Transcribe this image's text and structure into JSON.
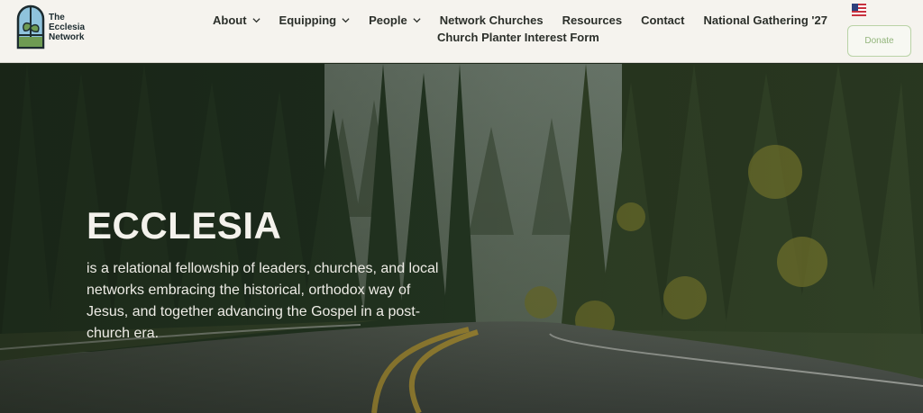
{
  "brand": {
    "name_line1": "The",
    "name_line2": "Ecclesia",
    "name_line3": "Network"
  },
  "nav": {
    "row1": [
      {
        "label": "About",
        "dropdown": true
      },
      {
        "label": "Equipping",
        "dropdown": true
      },
      {
        "label": "People",
        "dropdown": true
      },
      {
        "label": "Network Churches",
        "dropdown": false
      },
      {
        "label": "Resources",
        "dropdown": false
      },
      {
        "label": "Contact",
        "dropdown": false
      },
      {
        "label": "National Gathering '27",
        "dropdown": false
      }
    ],
    "row2": [
      {
        "label": "Church Planter Interest Form",
        "dropdown": false
      }
    ]
  },
  "language_flag": "us-flag-icon",
  "donate": {
    "label": "Donate"
  },
  "hero": {
    "title": "ECCLESIA",
    "text": "is a relational fellowship of leaders, churches, and local networks embracing the historical, orthodox way of Jesus, and together advancing the Gospel in a post-church era."
  },
  "colors": {
    "header_bg": "#f5f3ee",
    "nav_text": "#2b2f2a",
    "donate_border": "#b9d3a6",
    "donate_text": "#93b57c",
    "hero_text": "#f4f2ec"
  }
}
